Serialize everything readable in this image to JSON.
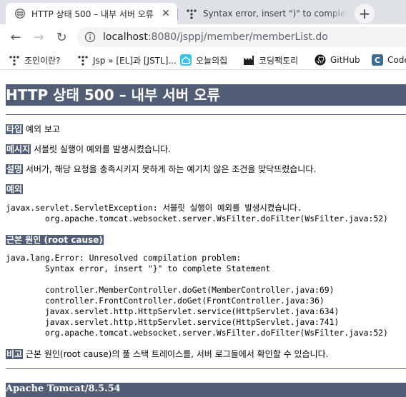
{
  "browser": {
    "tabs": [
      {
        "title": "HTTP 상태 500 – 내부 서버 오류",
        "close": "✕"
      },
      {
        "title": "Syntax error, insert \")\" to complete"
      }
    ],
    "new_tab": "+",
    "nav": {
      "back": "←",
      "forward": "→",
      "reload": "↻"
    },
    "url_host": "localhost",
    "url_path": ":8080/jsppj/member/memberList.do",
    "bookmarks": [
      {
        "label": "조인이란?",
        "icon": "dots-icon"
      },
      {
        "label": "Jsp » [EL]과 [JSTL]...",
        "icon": "dots-icon"
      },
      {
        "label": "오늘의집",
        "icon": "house-icon"
      },
      {
        "label": "코딩팩토리",
        "icon": "factory-icon"
      },
      {
        "label": "GitHub",
        "icon": "github-icon"
      },
      {
        "label": "Code",
        "icon": "c-icon"
      }
    ]
  },
  "error_page": {
    "title": "HTTP 상태 500 – 내부 서버 오류",
    "type_label": "타입",
    "type_value": "예외 보고",
    "message_label": "메시지",
    "message_value": "서블릿 실행이 예외를 발생시켰습니다.",
    "description_label": "설명",
    "description_value": "서버가, 해당 요청을 충족시키지 못하게 하는 예기치 않은 조건을 맞닥뜨렸습니다.",
    "exception_label": "예외",
    "exception_trace": "javax.servlet.ServletException: 서블릿 실행이 예외를 발생시켰습니다.\n\torg.apache.tomcat.websocket.server.WsFilter.doFilter(WsFilter.java:52)",
    "root_cause_label": "근본 원인 (root cause)",
    "root_cause_trace": "java.lang.Error: Unresolved compilation problem: \n\tSyntax error, insert \"}\" to complete Statement\n\n\tcontroller.MemberController.doGet(MemberController.java:69)\n\tcontroller.FrontController.doGet(FrontController.java:36)\n\tjavax.servlet.http.HttpServlet.service(HttpServlet.java:634)\n\tjavax.servlet.http.HttpServlet.service(HttpServlet.java:741)\n\torg.apache.tomcat.websocket.server.WsFilter.doFilter(WsFilter.java:52)",
    "note_label": "비고",
    "note_value": "근본 원인(root cause)의 풀 스택 트레이스를, 서버 로그들에서 확인할 수 있습니다.",
    "footer": "Apache Tomcat/8.5.54"
  },
  "colors": {
    "accent": "#525d76",
    "tabstrip": "#dee1e6",
    "omnibox": "#f1f3f4"
  }
}
